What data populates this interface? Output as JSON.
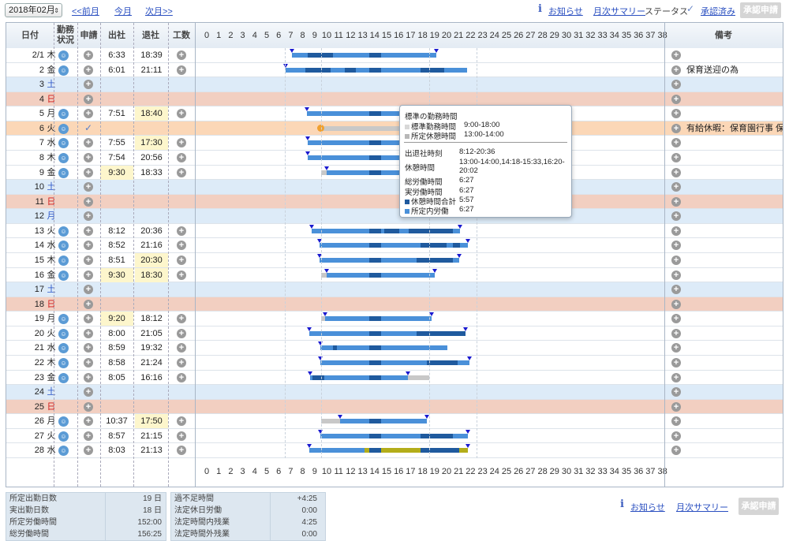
{
  "toolbar": {
    "month": "2018年02月",
    "prev": "<<前月",
    "this": "今月",
    "next": "次月>>",
    "notice": "お知らせ",
    "monthly_summary": "月次サマリー",
    "status_label": "ステータス",
    "status_value": "承認済み",
    "approve_request": "承認申請"
  },
  "headers": {
    "date": "日付",
    "work_status_1": "勤務",
    "work_status_2": "状況",
    "request": "申請",
    "clock_in": "出社",
    "clock_out": "退社",
    "man_hours": "工数",
    "remarks": "備考",
    "hours": [
      "0",
      "1",
      "2",
      "3",
      "4",
      "5",
      "6",
      "7",
      "8",
      "9",
      "10",
      "11",
      "12",
      "13",
      "14",
      "15",
      "16",
      "17",
      "18",
      "19",
      "20",
      "21",
      "22",
      "23",
      "24",
      "25",
      "26",
      "27",
      "28",
      "29",
      "30",
      "31",
      "32",
      "33",
      "34",
      "35",
      "36",
      "37",
      "38"
    ]
  },
  "rows": [
    {
      "date": "2/1",
      "wd": "木",
      "type": "work",
      "face": true,
      "in": "6:33",
      "out": "18:39",
      "note": "",
      "bars": [
        [
          "l",
          6.55,
          7.9
        ],
        [
          "d",
          7.9,
          10
        ],
        [
          "l",
          10,
          13
        ],
        [
          "d",
          13,
          14
        ],
        [
          "l",
          14,
          18.65
        ]
      ],
      "ticks": [
        6.55,
        18.65
      ]
    },
    {
      "date": "2",
      "wd": "金",
      "type": "work",
      "face": true,
      "in": "6:01",
      "out": "21:11",
      "note": "保育送迎の為",
      "bars": [
        [
          "l",
          6.02,
          7.7
        ],
        [
          "d",
          7.7,
          9.8
        ],
        [
          "l",
          9.8,
          11
        ],
        [
          "d",
          11,
          11.9
        ],
        [
          "l",
          11.9,
          13
        ],
        [
          "d",
          13,
          14
        ],
        [
          "l",
          14,
          17.3
        ],
        [
          "d",
          17.3,
          19.3
        ],
        [
          "l",
          19.3,
          21.18
        ]
      ],
      "ticks": [
        6.02
      ]
    },
    {
      "date": "3",
      "wd": "土",
      "type": "sat",
      "face": false,
      "in": "",
      "out": "",
      "note": "",
      "bars": [],
      "ticks": []
    },
    {
      "date": "4",
      "wd": "日",
      "type": "sun",
      "face": false,
      "in": "",
      "out": "",
      "note": "",
      "bars": [],
      "ticks": []
    },
    {
      "date": "5",
      "wd": "月",
      "type": "work",
      "face": true,
      "in": "7:51",
      "out": "18:40",
      "note": "",
      "bars": [
        [
          "l",
          7.85,
          13
        ],
        [
          "d",
          13,
          14
        ],
        [
          "l",
          14,
          17
        ]
      ],
      "ticks": [
        7.85
      ]
    },
    {
      "date": "6",
      "wd": "火",
      "type": "hol",
      "face": true,
      "in": "",
      "out": "",
      "note": "有給休暇：保育園行事 保育...",
      "bars": [
        [
          "g",
          9,
          17
        ]
      ],
      "ticks": []
    },
    {
      "date": "7",
      "wd": "水",
      "type": "work",
      "face": true,
      "in": "7:55",
      "out": "17:30",
      "note": "",
      "bars": [
        [
          "l",
          7.92,
          13
        ],
        [
          "d",
          13,
          14
        ],
        [
          "l",
          14,
          17
        ]
      ],
      "ticks": [
        7.92
      ]
    },
    {
      "date": "8",
      "wd": "木",
      "type": "work",
      "face": true,
      "in": "7:54",
      "out": "20:56",
      "note": "",
      "bars": [
        [
          "l",
          7.9,
          13
        ],
        [
          "d",
          13,
          14
        ],
        [
          "l",
          14,
          17
        ]
      ],
      "ticks": [
        7.9
      ]
    },
    {
      "date": "9",
      "wd": "金",
      "type": "work",
      "face": true,
      "in": "9:30",
      "out": "18:33",
      "note": "",
      "bars": [
        [
          "g",
          9,
          9.5
        ],
        [
          "l",
          9.5,
          13
        ],
        [
          "d",
          13,
          14
        ],
        [
          "l",
          14,
          17
        ]
      ],
      "ticks": [
        9.5
      ]
    },
    {
      "date": "10",
      "wd": "土",
      "type": "sat",
      "face": false,
      "in": "",
      "out": "",
      "note": "",
      "bars": [],
      "ticks": []
    },
    {
      "date": "11",
      "wd": "日",
      "type": "sun",
      "face": false,
      "in": "",
      "out": "",
      "note": "",
      "bars": [],
      "ticks": []
    },
    {
      "date": "12",
      "wd": "月",
      "type": "sat",
      "face": false,
      "in": "",
      "out": "",
      "note": "",
      "bars": [],
      "ticks": []
    },
    {
      "date": "13",
      "wd": "火",
      "type": "work",
      "face": true,
      "in": "8:12",
      "out": "20:36",
      "note": "",
      "bars": [
        [
          "l",
          8.2,
          13
        ],
        [
          "d",
          13,
          14
        ],
        [
          "l",
          14,
          14.3
        ],
        [
          "d",
          14.3,
          15.55
        ],
        [
          "l",
          15.55,
          16.33
        ],
        [
          "d",
          16.33,
          20
        ],
        [
          "l",
          20,
          20.6
        ]
      ],
      "ticks": [
        8.2,
        20.6
      ]
    },
    {
      "date": "14",
      "wd": "水",
      "type": "work",
      "face": true,
      "in": "8:52",
      "out": "21:16",
      "note": "",
      "bars": [
        [
          "l",
          8.87,
          13
        ],
        [
          "d",
          13,
          14
        ],
        [
          "l",
          14,
          17.3
        ],
        [
          "d",
          17.3,
          19.5
        ],
        [
          "l",
          19.5,
          20
        ],
        [
          "d",
          20,
          20.6
        ],
        [
          "l",
          20.6,
          21.27
        ]
      ],
      "ticks": [
        8.87,
        21.27
      ]
    },
    {
      "date": "15",
      "wd": "木",
      "type": "work",
      "face": true,
      "in": "8:51",
      "out": "20:30",
      "note": "",
      "bars": [
        [
          "l",
          8.85,
          13
        ],
        [
          "d",
          13,
          14
        ],
        [
          "l",
          14,
          17
        ],
        [
          "d",
          17,
          20
        ],
        [
          "l",
          20,
          20.5
        ]
      ],
      "ticks": [
        8.85,
        20.5
      ]
    },
    {
      "date": "16",
      "wd": "金",
      "type": "work",
      "face": true,
      "in": "9:30",
      "out": "18:30",
      "note": "",
      "bars": [
        [
          "g",
          9,
          9.5
        ],
        [
          "l",
          9.5,
          13
        ],
        [
          "d",
          13,
          14
        ],
        [
          "l",
          14,
          18.5
        ]
      ],
      "ticks": [
        9.5,
        18.5
      ]
    },
    {
      "date": "17",
      "wd": "土",
      "type": "sat",
      "face": false,
      "in": "",
      "out": "",
      "note": "",
      "bars": [],
      "ticks": []
    },
    {
      "date": "18",
      "wd": "日",
      "type": "sun",
      "face": false,
      "in": "",
      "out": "",
      "note": "",
      "bars": [],
      "ticks": []
    },
    {
      "date": "19",
      "wd": "月",
      "type": "work",
      "face": true,
      "in": "9:20",
      "out": "18:12",
      "note": "",
      "bars": [
        [
          "g",
          9,
          9.33
        ],
        [
          "l",
          9.33,
          13
        ],
        [
          "d",
          13,
          14
        ],
        [
          "l",
          14,
          18.2
        ]
      ],
      "ticks": [
        9.33,
        18.2
      ]
    },
    {
      "date": "20",
      "wd": "火",
      "type": "work",
      "face": true,
      "in": "8:00",
      "out": "21:05",
      "note": "",
      "bars": [
        [
          "l",
          8,
          13
        ],
        [
          "d",
          13,
          14
        ],
        [
          "l",
          14,
          17
        ],
        [
          "d",
          17,
          21.08
        ]
      ],
      "ticks": [
        8,
        21.08
      ]
    },
    {
      "date": "21",
      "wd": "水",
      "type": "work",
      "face": true,
      "in": "8:59",
      "out": "19:32",
      "note": "",
      "bars": [
        [
          "l",
          8.98,
          10
        ],
        [
          "d",
          10,
          10.3
        ],
        [
          "l",
          10.3,
          13
        ],
        [
          "d",
          13,
          14
        ],
        [
          "l",
          14,
          19.53
        ]
      ],
      "ticks": [
        8.98
      ]
    },
    {
      "date": "22",
      "wd": "木",
      "type": "work",
      "face": true,
      "in": "8:58",
      "out": "21:24",
      "note": "",
      "bars": [
        [
          "l",
          8.97,
          13
        ],
        [
          "d",
          13,
          14
        ],
        [
          "l",
          14,
          17.8
        ],
        [
          "d",
          17.8,
          20.4
        ],
        [
          "l",
          20.4,
          21.4
        ]
      ],
      "ticks": [
        8.97,
        21.4
      ]
    },
    {
      "date": "23",
      "wd": "金",
      "type": "work",
      "face": true,
      "in": "8:05",
      "out": "16:16",
      "note": "",
      "bars": [
        [
          "l",
          8.08,
          8.3
        ],
        [
          "d",
          8.3,
          9.3
        ],
        [
          "l",
          9.3,
          13
        ],
        [
          "d",
          13,
          14
        ],
        [
          "l",
          14,
          16.27
        ],
        [
          "g",
          16.27,
          18
        ]
      ],
      "ticks": [
        8.08,
        16.27
      ]
    },
    {
      "date": "24",
      "wd": "土",
      "type": "sat",
      "face": false,
      "in": "",
      "out": "",
      "note": "",
      "bars": [],
      "ticks": []
    },
    {
      "date": "25",
      "wd": "日",
      "type": "sun",
      "face": false,
      "in": "",
      "out": "",
      "note": "",
      "bars": [],
      "ticks": []
    },
    {
      "date": "26",
      "wd": "月",
      "type": "work",
      "face": true,
      "in": "10:37",
      "out": "17:50",
      "note": "",
      "bars": [
        [
          "g",
          9,
          10.62
        ],
        [
          "l",
          10.62,
          13
        ],
        [
          "d",
          13,
          14
        ],
        [
          "l",
          14,
          17.83
        ]
      ],
      "ticks": [
        10.62,
        17.83
      ]
    },
    {
      "date": "27",
      "wd": "火",
      "type": "work",
      "face": true,
      "in": "8:57",
      "out": "21:15",
      "note": "",
      "bars": [
        [
          "l",
          8.95,
          13
        ],
        [
          "d",
          13,
          14
        ],
        [
          "l",
          14,
          17.3
        ],
        [
          "d",
          17.3,
          20
        ],
        [
          "l",
          20,
          21.25
        ]
      ],
      "ticks": [
        8.95,
        21.25
      ]
    },
    {
      "date": "28",
      "wd": "水",
      "type": "work",
      "face": true,
      "in": "8:03",
      "out": "21:13",
      "note": "",
      "bars": [
        [
          "l",
          8.05,
          12.6
        ],
        [
          "o",
          12.6,
          13
        ],
        [
          "d",
          13,
          14
        ],
        [
          "o",
          14,
          17.3
        ],
        [
          "d",
          17.3,
          20.5
        ],
        [
          "o",
          20.5,
          21.22
        ]
      ],
      "ticks": [
        8.05,
        21.22
      ]
    }
  ],
  "tooltip": {
    "title": "標準の勤務時間",
    "std_label": "標準勤務時間",
    "std_value": "9:00-18:00",
    "break_label": "所定休憩時間",
    "break_value": "13:00-14:00",
    "in_out_label": "出退社時刻",
    "in_out_value": "8:12-20:36",
    "rest_label": "休憩時間",
    "rest_value": "13:00-14:00,14:18-15:33,16:20-20:02",
    "total_label": "総労働時間",
    "total_value": "6:27",
    "actual_label": "実労働時間",
    "actual_value": "6:27",
    "rest_total_label": "休憩時間合計",
    "rest_total_value": "5:57",
    "scheduled_label": "所定内労働",
    "scheduled_value": "6:27"
  },
  "summary": {
    "left": [
      {
        "k": "所定出勤日数",
        "v": "19 日"
      },
      {
        "k": "実出勤日数",
        "v": "18 日"
      },
      {
        "k": "所定労働時間",
        "v": "152:00"
      },
      {
        "k": "総労働時間",
        "v": "156:25"
      }
    ],
    "right": [
      {
        "k": "過不足時間",
        "v": "+4:25"
      },
      {
        "k": "法定休日労働",
        "v": "0:00"
      },
      {
        "k": "法定時間内残業",
        "v": "4:25"
      },
      {
        "k": "法定時間外残業",
        "v": "0:00"
      }
    ]
  },
  "colors": {
    "sat": "#ddebf8",
    "sun": "#f2cfc1",
    "holiday": "#fbd7b7",
    "bar_light": "#4a90d9",
    "bar_dark": "#1f5a9e",
    "link": "#2a4fc0"
  },
  "icons": {
    "face": "smile-face-icon",
    "plus": "plus-circle-icon",
    "check": "checkmark-icon",
    "info": "info-i-icon"
  }
}
